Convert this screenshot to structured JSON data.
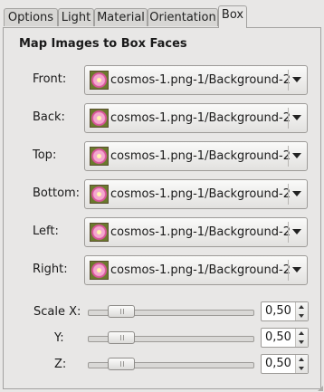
{
  "tabs": [
    {
      "label": "Options",
      "active": false
    },
    {
      "label": "Light",
      "active": false
    },
    {
      "label": "Material",
      "active": false
    },
    {
      "label": "Orientation",
      "active": false
    },
    {
      "label": "Box",
      "active": true
    }
  ],
  "heading": "Map Images to Box Faces",
  "faces": [
    {
      "label": "Front:",
      "value": "cosmos-1.png-1/Background-2",
      "icon": "image-thumbnail-icon"
    },
    {
      "label": "Back:",
      "value": "cosmos-1.png-1/Background-2",
      "icon": "image-thumbnail-icon"
    },
    {
      "label": "Top:",
      "value": "cosmos-1.png-1/Background-2",
      "icon": "image-thumbnail-icon"
    },
    {
      "label": "Bottom:",
      "value": "cosmos-1.png-1/Background-2",
      "icon": "image-thumbnail-icon"
    },
    {
      "label": "Left:",
      "value": "cosmos-1.png-1/Background-2",
      "icon": "image-thumbnail-icon"
    },
    {
      "label": "Right:",
      "value": "cosmos-1.png-1/Background-2",
      "icon": "image-thumbnail-icon"
    }
  ],
  "scales": [
    {
      "label": "Scale X:",
      "value": "0,50",
      "fraction": 0.14
    },
    {
      "label": "Y:",
      "value": "0,50",
      "fraction": 0.14
    },
    {
      "label": "Z:",
      "value": "0,50",
      "fraction": 0.14
    }
  ]
}
